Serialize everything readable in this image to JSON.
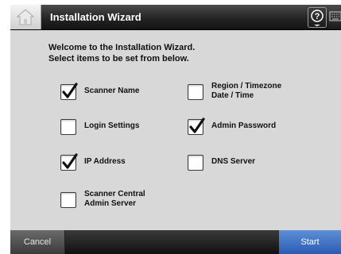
{
  "titlebar": {
    "title": "Installation Wizard",
    "home_icon": "home-icon",
    "help_icon": "help-icon",
    "keyboard_icon": "keyboard-icon"
  },
  "intro": {
    "line1": "Welcome to the Installation Wizard.",
    "line2": "Select items to be set from below."
  },
  "options": [
    {
      "line1": "Scanner Name",
      "line2": "",
      "checked": true
    },
    {
      "line1": "Region / Timezone",
      "line2": "Date / Time",
      "checked": false
    },
    {
      "line1": "Login Settings",
      "line2": "",
      "checked": false
    },
    {
      "line1": "Admin Password",
      "line2": "",
      "checked": true
    },
    {
      "line1": "IP Address",
      "line2": "",
      "checked": true
    },
    {
      "line1": "DNS Server",
      "line2": "",
      "checked": false
    },
    {
      "line1": "Scanner Central",
      "line2": "Admin Server",
      "checked": false
    }
  ],
  "footer": {
    "cancel_label": "Cancel",
    "start_label": "Start"
  },
  "colors": {
    "title_bar": "#1e1e1e",
    "content_bg": "#d8d8d8",
    "start_button": "#3a6fc4"
  }
}
